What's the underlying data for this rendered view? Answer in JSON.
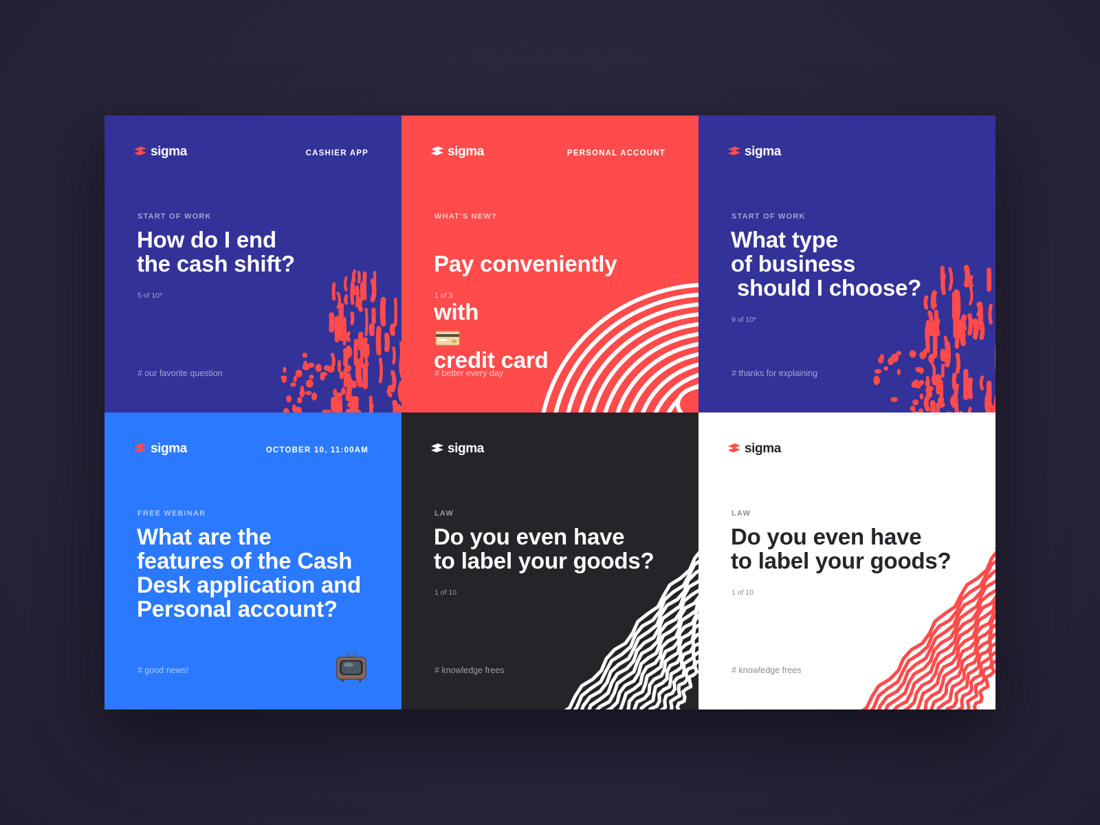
{
  "brand": {
    "name": "sigma",
    "logo_color": "#ff4b4b",
    "icon": "sigma-logo-icon"
  },
  "colors": {
    "navy": "#323298",
    "coral": "#ff4b4b",
    "bright_blue": "#2b79ff",
    "charcoal": "#262429",
    "white": "#ffffff"
  },
  "cards": [
    {
      "topright": "CASHIER APP",
      "category": "START OF WORK",
      "title": "How do I end\nthe cash shift?",
      "counter": "5 of 10*",
      "tag": "# our favorite question",
      "decoration": "coral-blobs"
    },
    {
      "topright": "PERSONAL ACCOUNT",
      "category": "WHAT'S NEW?",
      "title_line1": "Pay conveniently",
      "title_line2_pre": "with",
      "title_line2_post": "credit card",
      "title_icon": "credit-card-icon",
      "counter": "1 of 3",
      "tag": "# better every day",
      "decoration": "white-rings"
    },
    {
      "topright": "",
      "category": "START OF WORK",
      "title": "What type\nof business\n should I choose?",
      "counter": "9 of 10*",
      "tag": "# thanks for explaining",
      "decoration": "coral-blobs"
    },
    {
      "topright": "OCTOBER 10, 11:00AM",
      "category": "FREE WEBINAR",
      "title": "What are the\nfeatures of the Cash\nDesk application and\nPersonal account?",
      "counter": "",
      "tag": "# good news!",
      "tag_icon": "television-icon"
    },
    {
      "topright": "",
      "category": "LAW",
      "title": "Do you even have\nto label your goods?",
      "counter": "1 of 10",
      "tag": "# knowledge frees",
      "decoration": "white-waves"
    },
    {
      "topright": "",
      "category": "LAW",
      "title": "Do you even have\nto label your goods?",
      "counter": "1 of 10",
      "tag": "# knowledge frees",
      "decoration": "coral-waves"
    }
  ]
}
